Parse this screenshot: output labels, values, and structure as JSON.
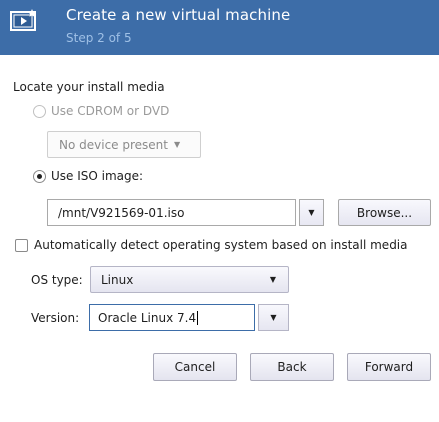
{
  "header": {
    "title": "Create a new virtual machine",
    "subtitle": "Step 2 of 5",
    "logo_icon": "virtual-machine-wizard-icon",
    "background_color": "#3d6da8"
  },
  "install_media": {
    "section_label": "Locate your install media",
    "cdrom_option": {
      "label": "Use CDROM or DVD",
      "selected": false,
      "enabled": false
    },
    "cdrom_device": {
      "value": "No device present",
      "enabled": false
    },
    "iso_option": {
      "label": "Use ISO image:",
      "selected": true
    },
    "iso_path": {
      "value": "/mnt/V921569-01.iso"
    },
    "browse_label": "Browse..."
  },
  "os_detect": {
    "label": "Automatically detect operating system based on install media",
    "checked": false
  },
  "os_type": {
    "label": "OS type:",
    "value": "Linux"
  },
  "version": {
    "label": "Version:",
    "value": "Oracle Linux 7.4"
  },
  "buttons": {
    "cancel": "Cancel",
    "back": "Back",
    "forward": "Forward"
  }
}
